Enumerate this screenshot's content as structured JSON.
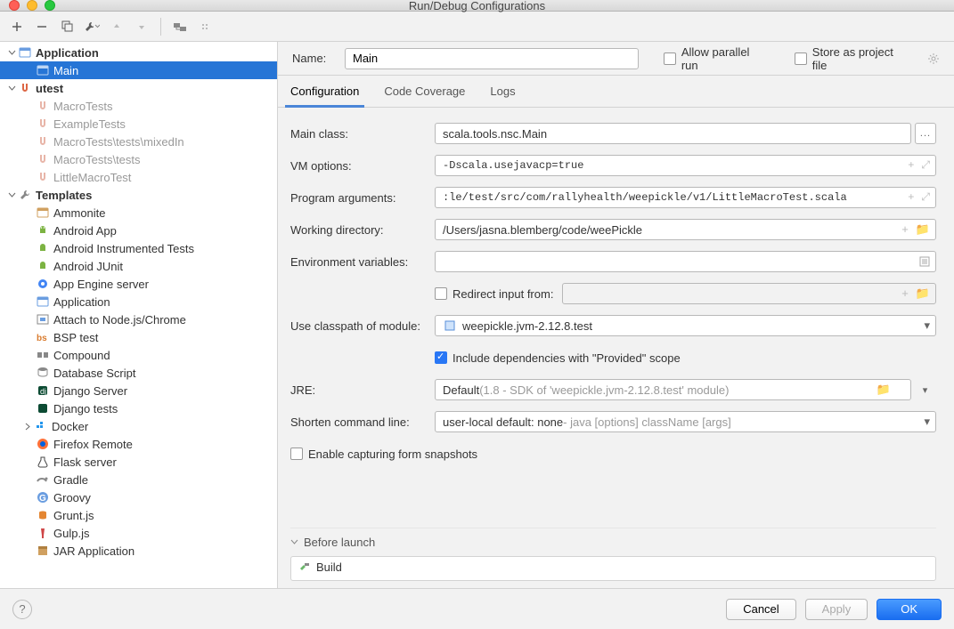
{
  "window": {
    "title": "Run/Debug Configurations"
  },
  "name_field": {
    "label": "Name:",
    "value": "Main"
  },
  "options": {
    "allow_parallel": "Allow parallel run",
    "store_project": "Store as project file"
  },
  "tabs": [
    "Configuration",
    "Code Coverage",
    "Logs"
  ],
  "form": {
    "main_class": {
      "label": "Main class:",
      "value": "scala.tools.nsc.Main",
      "browse": "..."
    },
    "vm_options": {
      "label": "VM options:",
      "value": "-Dscala.usejavacp=true"
    },
    "program_args": {
      "label": "Program arguments:",
      "value": ":le/test/src/com/rallyhealth/weepickle/v1/LittleMacroTest.scala"
    },
    "working_dir": {
      "label": "Working directory:",
      "value": "/Users/jasna.blemberg/code/weePickle"
    },
    "env_vars": {
      "label": "Environment variables:",
      "value": ""
    },
    "redirect": {
      "label": "Redirect input from:"
    },
    "classpath": {
      "label": "Use classpath of module:",
      "value": "weepickle.jvm-2.12.8.test"
    },
    "include_deps": "Include dependencies with \"Provided\" scope",
    "jre": {
      "label": "JRE:",
      "prefix": "Default",
      "hint": " (1.8 - SDK of 'weepickle.jvm-2.12.8.test' module)"
    },
    "shorten": {
      "label": "Shorten command line:",
      "prefix": "user-local default: none",
      "hint": " - java [options] className [args]"
    },
    "capture_snapshots": "Enable capturing form snapshots"
  },
  "before_launch": {
    "title": "Before launch",
    "items": [
      "Build"
    ]
  },
  "footer": {
    "cancel": "Cancel",
    "apply": "Apply",
    "ok": "OK",
    "help": "?"
  },
  "sidebar": {
    "application": {
      "label": "Application",
      "items": [
        "Main"
      ]
    },
    "utest": {
      "label": "utest",
      "items": [
        "MacroTests",
        "ExampleTests",
        "MacroTests\\tests\\mixedIn",
        "MacroTests\\tests",
        "LittleMacroTest"
      ]
    },
    "templates": {
      "label": "Templates",
      "items": [
        "Ammonite",
        "Android App",
        "Android Instrumented Tests",
        "Android JUnit",
        "App Engine server",
        "Application",
        "Attach to Node.js/Chrome",
        "BSP test",
        "Compound",
        "Database Script",
        "Django Server",
        "Django tests",
        "Docker",
        "Firefox Remote",
        "Flask server",
        "Gradle",
        "Groovy",
        "Grunt.js",
        "Gulp.js",
        "JAR Application"
      ]
    }
  }
}
